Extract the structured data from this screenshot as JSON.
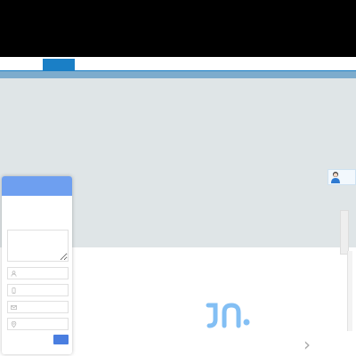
{
  "header": {
    "welcome_text": "",
    "sales_hotline": "",
    "service_hotline": ""
  },
  "nav": {
    "items": [
      {
        "label": "",
        "active": true
      },
      {
        "label": "",
        "active": false
      },
      {
        "label": "",
        "active": false
      },
      {
        "label": "",
        "active": false
      },
      {
        "label": "",
        "active": false
      },
      {
        "label": "",
        "active": false
      },
      {
        "label": "",
        "active": false
      },
      {
        "label": "",
        "active": false
      }
    ]
  },
  "online_service": {
    "label": "",
    "side_label": ""
  },
  "message_widget": {
    "title": "",
    "minimize_symbol": "",
    "intro": "",
    "message_placeholder": "",
    "fields": [
      {
        "placeholder": "",
        "icon": "user-icon"
      },
      {
        "placeholder": "",
        "icon": "phone-icon"
      },
      {
        "placeholder": "",
        "icon": "mail-icon"
      },
      {
        "placeholder": "",
        "icon": "location-icon"
      }
    ],
    "submit_label": ""
  },
  "watermark": {
    "title": "",
    "slogan": ""
  },
  "colors": {
    "nav_active": "#1a7fc6",
    "widget_header": "#6e9ff0",
    "submit_button": "#4a7ee0",
    "hotline_text": "#e8b23a",
    "banner_background": "#dfe5e7"
  }
}
